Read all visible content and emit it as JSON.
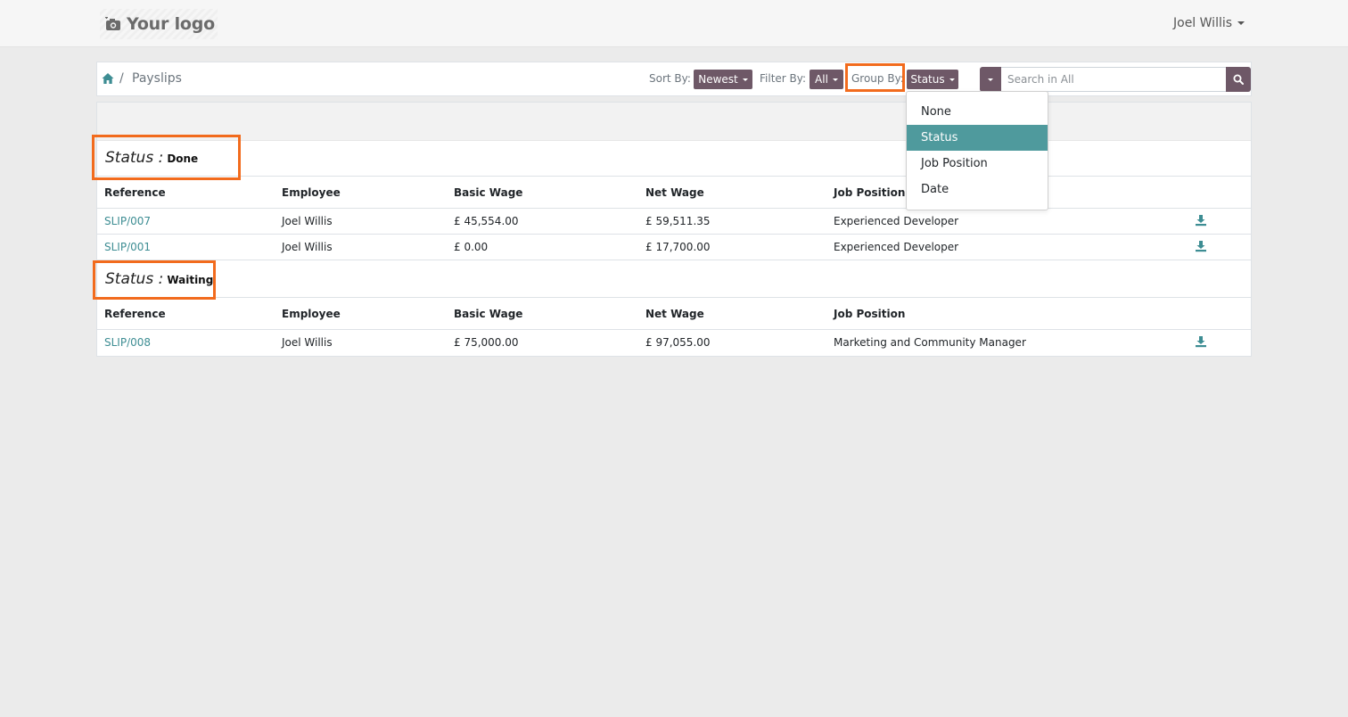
{
  "header": {
    "logo_text": "Your logo",
    "user_name": "Joel Willis"
  },
  "breadcrumb": {
    "current": "Payslips",
    "separator": "/"
  },
  "toolbar": {
    "sort_label": "Sort By:",
    "sort_value": "Newest",
    "filter_label": "Filter By:",
    "filter_value": "All",
    "group_label": "Group By:",
    "group_value": "Status",
    "search_placeholder": "Search in All"
  },
  "group_by_menu": {
    "options": [
      "None",
      "Status",
      "Job Position",
      "Date"
    ],
    "selected": "Status"
  },
  "table": {
    "columns": [
      "Reference",
      "Employee",
      "Basic Wage",
      "Net Wage",
      "Job Position"
    ],
    "groups": [
      {
        "label": "Status :",
        "value": "Done",
        "rows": [
          {
            "reference": "SLIP/007",
            "employee": "Joel Willis",
            "basic_wage": "£ 45,554.00",
            "net_wage": "£ 59,511.35",
            "job_position": "Experienced Developer"
          },
          {
            "reference": "SLIP/001",
            "employee": "Joel Willis",
            "basic_wage": "£ 0.00",
            "net_wage": "£ 17,700.00",
            "job_position": "Experienced Developer"
          }
        ]
      },
      {
        "label": "Status :",
        "value": "Waiting",
        "rows": [
          {
            "reference": "SLIP/008",
            "employee": "Joel Willis",
            "basic_wage": "£ 75,000.00",
            "net_wage": "£ 97,055.00",
            "job_position": "Marketing and Community Manager"
          }
        ]
      }
    ]
  },
  "colors": {
    "accent": "#4f9a9d",
    "button": "#6e5867",
    "link": "#3d8d93",
    "highlight": "#f26b1d"
  },
  "icons": {
    "home": "home-icon",
    "search": "search-icon",
    "download": "download-icon",
    "logo": "camera-icon"
  }
}
